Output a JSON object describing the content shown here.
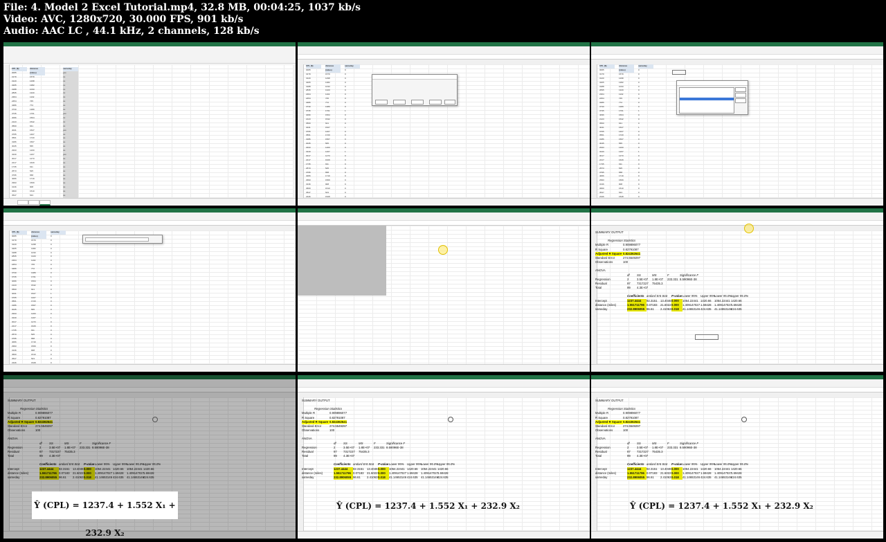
{
  "header": {
    "file_line": "File: 4. Model 2 Excel Tutorial.mp4, 32.8 MB, 00:04:25, 1037 kb/s",
    "video_line": "Video: AVC, 1280x720, 30.000 FPS, 901 kb/s",
    "audio_line": "Audio: AAC LC , 44.1 kHz, 2 channels, 128 kb/s"
  },
  "thumbnails": {
    "t1": {
      "column_headers": [
        "CPL ($)",
        "distance (miles)",
        "sameday"
      ],
      "cpl": [
        "3065",
        "3179",
        "3120",
        "3205",
        "3188",
        "2835",
        "2364",
        "2454",
        "3486",
        "3730",
        "3735",
        "4096",
        "2123",
        "3560",
        "4041",
        "3765",
        "3561",
        "3186",
        "3045",
        "2933",
        "3240",
        "3017",
        "2217",
        "1735",
        "2573",
        "3795",
        "4066",
        "2993",
        "3136",
        "3660",
        "3547",
        "2346",
        "2988"
      ],
      "distance": [
        "1579",
        "1298",
        "1382",
        "1033",
        "1320",
        "1102",
        "745",
        "772",
        "1389",
        "1761",
        "1564",
        "1542",
        "641",
        "1527",
        "1407",
        "1720",
        "1507",
        "565",
        "1200",
        "1207",
        "1273",
        "1629",
        "911",
        "525",
        "658",
        "1719",
        "1569",
        "908",
        "1510",
        "543",
        "1528",
        "1007",
        "1364"
      ],
      "sameday": [
        "yes",
        "no",
        "no",
        "no",
        "no",
        "no",
        "no",
        "no",
        "no",
        "no",
        "yes",
        "no",
        "no",
        "no",
        "yes",
        "no",
        "no",
        "no",
        "no",
        "no",
        "yes",
        "no",
        "no",
        "no",
        "no",
        "no",
        "no",
        "no",
        "no",
        "no",
        "no",
        "no",
        "no"
      ]
    },
    "t2": {
      "column_headers": [
        "CPL ($)",
        "distance (miles)",
        "sameday"
      ],
      "sameday": [
        "0",
        "0",
        "0",
        "0",
        "0",
        "0",
        "0",
        "0",
        "0",
        "0",
        "1",
        "0",
        "0",
        "0",
        "1",
        "0",
        "0",
        "0",
        "0",
        "0",
        "1",
        "0",
        "0",
        "0",
        "0",
        "0",
        "0",
        "0",
        "0",
        "0",
        "0",
        "0",
        "0"
      ],
      "dialog_title": "Find and Replace"
    },
    "t3": {
      "dialog_title": "Data Analysis"
    },
    "t4": {
      "dialog_title": "Regression"
    },
    "t6": {
      "summary_output": "SUMMARY OUTPUT",
      "regression_statistics": "Regression Statistics",
      "stats": [
        {
          "label": "Multiple R",
          "value": "0.909896077"
        },
        {
          "label": "R Square",
          "value": "0.82791087"
        },
        {
          "label": "Adjusted R Square",
          "value": "0.824362641"
        },
        {
          "label": "Standard Error",
          "value": "274.6549297"
        },
        {
          "label": "Observations",
          "value": "100"
        }
      ],
      "anova": "ANOVA",
      "anova_headers": [
        "df",
        "SS",
        "MS",
        "F",
        "Significance F"
      ],
      "anova_rows": [
        {
          "label": "Regression",
          "df": "2",
          "ss": "3.5E+07",
          "ms": "1.8E+07",
          "f": "233.331",
          "sig": "8.59096E-38"
        },
        {
          "label": "Residual",
          "df": "97",
          "ss": "7317227",
          "ms": "75435.3",
          "f": "",
          "sig": ""
        },
        {
          "label": "Total",
          "df": "99",
          "ss": "4.3E+07",
          "ms": "",
          "f": "",
          "sig": ""
        }
      ],
      "coef_headers": [
        "Coefficients",
        "andard Err.",
        "t Stat",
        "P-value",
        "Lower 95%",
        "Upper 95%",
        "Lower 95.0%",
        "Upper 95.0%"
      ],
      "coef_rows": [
        {
          "label": "Intercept",
          "coef": "1237.4444",
          "se": "92.3151",
          "t": "13.4046",
          "p": "0.000",
          "lo": "1054.22441",
          "up": "1420.66",
          "lo2": "1054.22441",
          "up2": "1420.66"
        },
        {
          "label": "distance (miles)",
          "coef": "1.551711796",
          "se": "0.07183",
          "t": "21.6022",
          "p": "0.000",
          "lo": "1.409147027",
          "up": "1.69428",
          "lo2": "1.409147027",
          "up2": "1.69428"
        },
        {
          "label": "sameday",
          "coef": "232.8906055",
          "se": "96.61",
          "t": "2.41063",
          "p": "0.018",
          "lo": "41.14653146",
          "up": "424.635",
          "lo2": "41.14653146",
          "up2": "424.635"
        }
      ]
    },
    "equation": "Ŷ (CPL) = 1237.4 + 1.552 X₁ + 232.9 X₂"
  }
}
